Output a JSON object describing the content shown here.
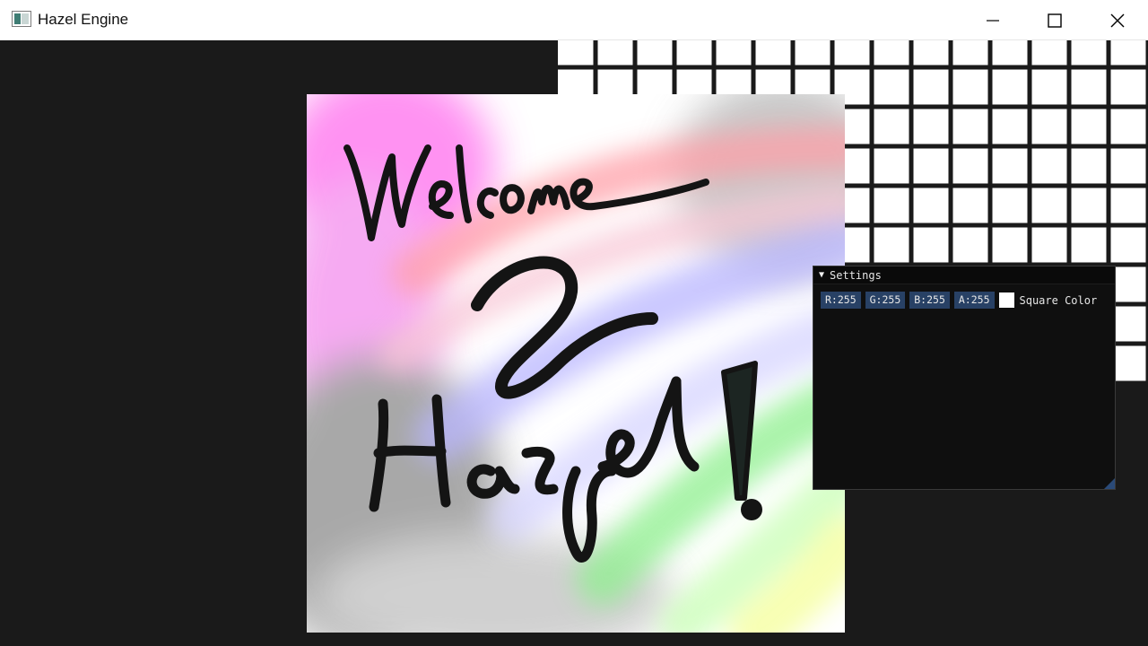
{
  "window": {
    "title": "Hazel Engine",
    "icon": "app-icon"
  },
  "titlebar_buttons": {
    "minimize_icon": "minimize-icon",
    "maximize_icon": "maximize-icon",
    "close_icon": "close-icon"
  },
  "scene": {
    "background_color": "#1a1a1a",
    "grid_quad": {
      "fill": "#ffffff",
      "line_color": "#1a1a1a",
      "columns": 16,
      "rows": 9
    },
    "welcome_quad": {
      "text_line1": "Welcome",
      "text_line2": "2",
      "text_line3": "Hazel!"
    }
  },
  "settings_panel": {
    "title": "Settings",
    "collapse_icon": "triangle-down-icon",
    "color_edit": {
      "r": "R:255",
      "g": "G:255",
      "b": "B:255",
      "a": "A:255",
      "swatch_color": "#ffffff",
      "label": "Square Color"
    }
  }
}
